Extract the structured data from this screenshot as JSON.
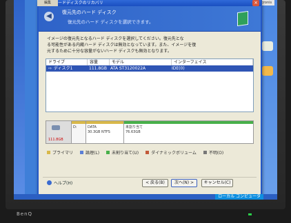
{
  "window": {
    "title": "ハードディスクのリカバリ",
    "close_glyph": "×"
  },
  "desktop": {
    "top_tab": "編集",
    "top_right_button": "Acronis"
  },
  "header": {
    "title": "復元先のハード ディスク",
    "subtitle": "復元先のハード ディスクを選択できます。"
  },
  "description": [
    "イメージの復元先となるハード ディスクを選択してください。復元先とな",
    "る可能性がある内蔵ハード ディスクは無効となっています。また、イメージを復",
    "元するために十分な容量がないハード ディスクも無効となります。"
  ],
  "disk_list": {
    "columns": [
      "ドライブ",
      "容量",
      "モデル",
      "インターフェイス"
    ],
    "rows": [
      {
        "drive": "ディスク1",
        "capacity": "111.8GB",
        "model": "ATA ST3120022A",
        "interface": "IDE(0)"
      }
    ]
  },
  "disk_map": {
    "capacity": "111.8GB",
    "partitions": [
      {
        "label": "D:",
        "detail": ""
      },
      {
        "label": "DATA",
        "detail": "30.3GB NTFS"
      },
      {
        "label": "未割り当て",
        "detail": "76.63GB"
      }
    ]
  },
  "legend": [
    {
      "label": "プライマリ",
      "color": "#d8b84a"
    },
    {
      "label": "論理(L)",
      "color": "#5b7fd6"
    },
    {
      "label": "未割り当て(U)",
      "color": "#48b04a"
    },
    {
      "label": "ダイナミックボリューム",
      "color": "#c25a3a"
    },
    {
      "label": "不明(O)",
      "color": "#777777"
    }
  ],
  "buttons": {
    "help": "ヘルプ(H)",
    "back": "< 戻る(B)",
    "next": "次へ(N) >",
    "cancel": "キャンセル(C)"
  },
  "taskbar": {
    "tray_text": "ローカル コンピュータ"
  },
  "monitor": {
    "brand": "BenQ"
  }
}
